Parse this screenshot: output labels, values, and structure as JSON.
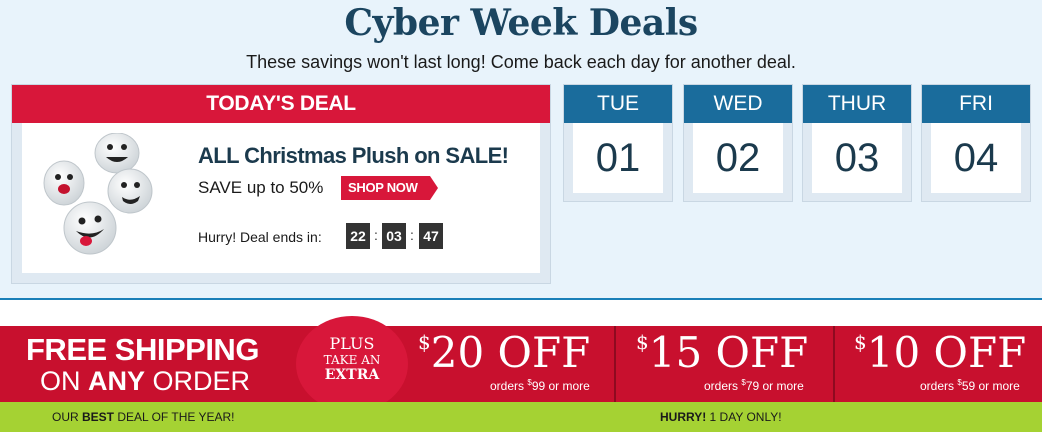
{
  "header": {
    "title": "Cyber Week Deals",
    "subtitle": "These savings won't last long! Come back each day for another deal."
  },
  "todays_deal": {
    "header": "TODAY'S DEAL",
    "title": "ALL Christmas Plush on SALE!",
    "save_text": "SAVE up to 50%",
    "shop_button": "SHOP NOW",
    "hurry_label": "Hurry! Deal ends in:",
    "countdown": {
      "hours": "22",
      "minutes": "03",
      "seconds": "47",
      "separator": ":"
    },
    "image_icon": "snowball-plush-faces"
  },
  "days": [
    {
      "name": "TUE",
      "date": "01"
    },
    {
      "name": "WED",
      "date": "02"
    },
    {
      "name": "THUR",
      "date": "03"
    },
    {
      "name": "FRI",
      "date": "04"
    }
  ],
  "promo": {
    "free_line1": "FREE SHIPPING",
    "free_line2_pre": "ON ",
    "free_line2_bold": "ANY",
    "free_line2_post": " ORDER",
    "plus_1": "PLUS",
    "plus_2": "TAKE AN",
    "plus_3": "EXTRA",
    "offers": [
      {
        "currency": "$",
        "amount": "20 OFF",
        "note_pre": "orders ",
        "note_currency": "$",
        "note_value": "99",
        "note_post": " or more"
      },
      {
        "currency": "$",
        "amount": "15 OFF",
        "note_pre": "orders ",
        "note_currency": "$",
        "note_value": "79",
        "note_post": " or more"
      },
      {
        "currency": "$",
        "amount": "10 OFF",
        "note_pre": "orders ",
        "note_currency": "$",
        "note_value": "59",
        "note_post": " or more"
      }
    ]
  },
  "bottom_bar": {
    "best_pre": "OUR ",
    "best_bold": "BEST",
    "best_post": " DEAL OF THE YEAR!",
    "hurry_bold": "HURRY!",
    "hurry_post": " 1 DAY ONLY!"
  },
  "colors": {
    "title": "#1b4560",
    "deal_red": "#d8173a",
    "day_blue": "#1a6c9c",
    "promo_red": "#c8102e",
    "green": "#a5d233",
    "background": "#e8f3fb"
  }
}
